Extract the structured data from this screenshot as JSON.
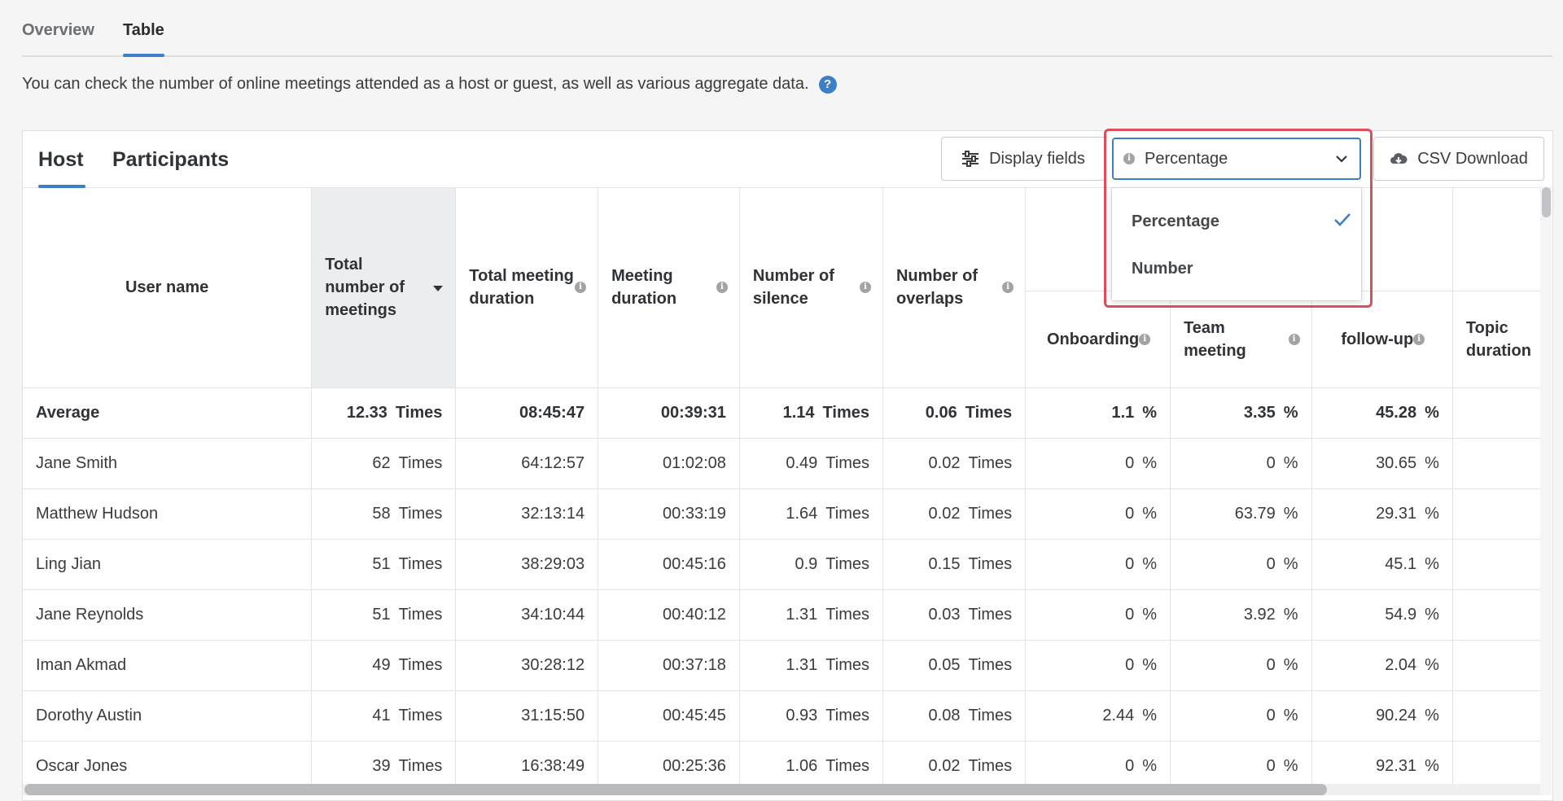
{
  "tabs": [
    {
      "label": "Overview",
      "active": false
    },
    {
      "label": "Table",
      "active": true
    }
  ],
  "description": "You can check the number of online meetings attended as a host or guest, as well as various aggregate data.",
  "subtabs": [
    {
      "label": "Host",
      "active": true
    },
    {
      "label": "Participants",
      "active": false
    }
  ],
  "toolbar": {
    "display_fields_label": "Display fields",
    "select_value": "Percentage",
    "csv_label": "CSV Download"
  },
  "dropdown": {
    "options": [
      {
        "label": "Percentage",
        "selected": true
      },
      {
        "label": "Number",
        "selected": false
      }
    ]
  },
  "columns": {
    "user_name": "User name",
    "total_meetings": "Total number of meetings",
    "total_duration": "Total meeting duration",
    "meeting_duration": "Meeting duration",
    "silence": "Number of silence",
    "overlaps": "Number of overlaps",
    "onboarding": "Onboarding",
    "team_meeting": "Team meeting",
    "follow_up": "follow-up",
    "topic_duration": "Topic duration"
  },
  "units": {
    "times": "Times",
    "percent": "%"
  },
  "average": {
    "name": "Average",
    "meetings": "12.33",
    "total_duration": "08:45:47",
    "meeting_duration": "00:39:31",
    "silence": "1.14",
    "overlaps": "0.06",
    "onboarding": "1.1",
    "team_meeting": "3.35",
    "follow_up": "45.28"
  },
  "rows": [
    {
      "name": "Jane Smith",
      "meetings": "62",
      "total_duration": "64:12:57",
      "meeting_duration": "01:02:08",
      "silence": "0.49",
      "overlaps": "0.02",
      "onboarding": "0",
      "team_meeting": "0",
      "follow_up": "30.65"
    },
    {
      "name": "Matthew Hudson",
      "meetings": "58",
      "total_duration": "32:13:14",
      "meeting_duration": "00:33:19",
      "silence": "1.64",
      "overlaps": "0.02",
      "onboarding": "0",
      "team_meeting": "63.79",
      "follow_up": "29.31"
    },
    {
      "name": "Ling Jian",
      "meetings": "51",
      "total_duration": "38:29:03",
      "meeting_duration": "00:45:16",
      "silence": "0.9",
      "overlaps": "0.15",
      "onboarding": "0",
      "team_meeting": "0",
      "follow_up": "45.1"
    },
    {
      "name": "Jane Reynolds",
      "meetings": "51",
      "total_duration": "34:10:44",
      "meeting_duration": "00:40:12",
      "silence": "1.31",
      "overlaps": "0.03",
      "onboarding": "0",
      "team_meeting": "3.92",
      "follow_up": "54.9"
    },
    {
      "name": "Iman Akmad",
      "meetings": "49",
      "total_duration": "30:28:12",
      "meeting_duration": "00:37:18",
      "silence": "1.31",
      "overlaps": "0.05",
      "onboarding": "0",
      "team_meeting": "0",
      "follow_up": "2.04"
    },
    {
      "name": "Dorothy Austin",
      "meetings": "41",
      "total_duration": "31:15:50",
      "meeting_duration": "00:45:45",
      "silence": "0.93",
      "overlaps": "0.08",
      "onboarding": "2.44",
      "team_meeting": "0",
      "follow_up": "90.24"
    },
    {
      "name": "Oscar Jones",
      "meetings": "39",
      "total_duration": "16:38:49",
      "meeting_duration": "00:25:36",
      "silence": "1.06",
      "overlaps": "0.02",
      "onboarding": "0",
      "team_meeting": "0",
      "follow_up": "92.31"
    }
  ],
  "colors": {
    "accent": "#3d7ec9",
    "highlight": "#d9505c"
  }
}
